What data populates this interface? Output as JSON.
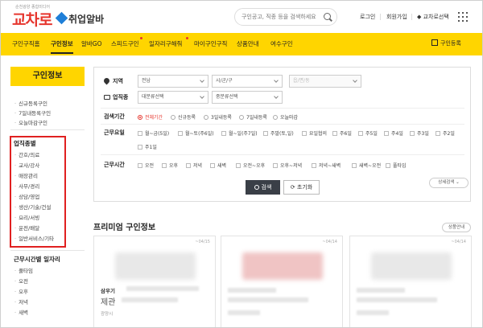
{
  "header": {
    "logo_sub": "순천광양 종합미디어",
    "logo_main": "교차로",
    "logo_brand": "취업알바",
    "search_placeholder": "구인공고, 직종 등을 검색하세요",
    "links": [
      "로그인",
      "회원가입",
      "교차로선택"
    ]
  },
  "nav": {
    "items": [
      "구인구직홈",
      "구인정보",
      "알바GO",
      "스피드구인",
      "일자리구해줘",
      "마이구인구직",
      "상품안내",
      "여수구인"
    ],
    "active_index": 1,
    "register_label": "구인등록"
  },
  "sidebar": {
    "title": "구인정보",
    "links": [
      "신규등록구인",
      "7일내등록구인",
      "오늘마감구인"
    ],
    "job_type_title": "업직종별",
    "job_types": [
      "간호/의료",
      "교사/강사",
      "매장관리",
      "사무/경리",
      "상담/영업",
      "생산/기술/건설",
      "요리/서빙",
      "운전/배달",
      "일반서비스/기타"
    ],
    "time_title": "근무시간별 일자리",
    "time_items": [
      "풀타임",
      "오전",
      "오후",
      "저녁",
      "새벽"
    ]
  },
  "filter": {
    "region_label": "지역",
    "region_selects": [
      "전남",
      "시/군/구",
      "읍/면/동"
    ],
    "industry_label": "업직종",
    "industry_selects": [
      "대분류선택",
      "중분류선택"
    ],
    "period_label": "검색기간",
    "period_options": [
      "전체기간",
      "신규등록",
      "3일내등록",
      "7일내등록",
      "오늘마감"
    ],
    "day_label": "근무요일",
    "day_options": [
      "월~금(5일)",
      "월~토(주6일)",
      "월~일(주7일)",
      "주말(토,일)",
      "요일협의",
      "주6일",
      "주5일",
      "주4일",
      "주3일",
      "주2일",
      "주1일"
    ],
    "time_label": "근무시간",
    "time_options": [
      "오전",
      "오후",
      "저녁",
      "새벽",
      "오전~오후",
      "오후~저녁",
      "저녁~새벽",
      "새벽~오전",
      "풀타임"
    ],
    "search_button": "검색",
    "reset_button": "초기화",
    "detail_button": "상세검색"
  },
  "premium": {
    "title": "프리미엄 구인정보",
    "more_button": "상품안내",
    "cards": [
      {
        "date": "~04/15",
        "company": "삼우기",
        "title": "제관",
        "region": "광양시"
      },
      {
        "date": "~04/14",
        "company": "",
        "title": "",
        "region": ""
      },
      {
        "date": "~04/14",
        "company": "",
        "title": "",
        "region": ""
      }
    ]
  }
}
